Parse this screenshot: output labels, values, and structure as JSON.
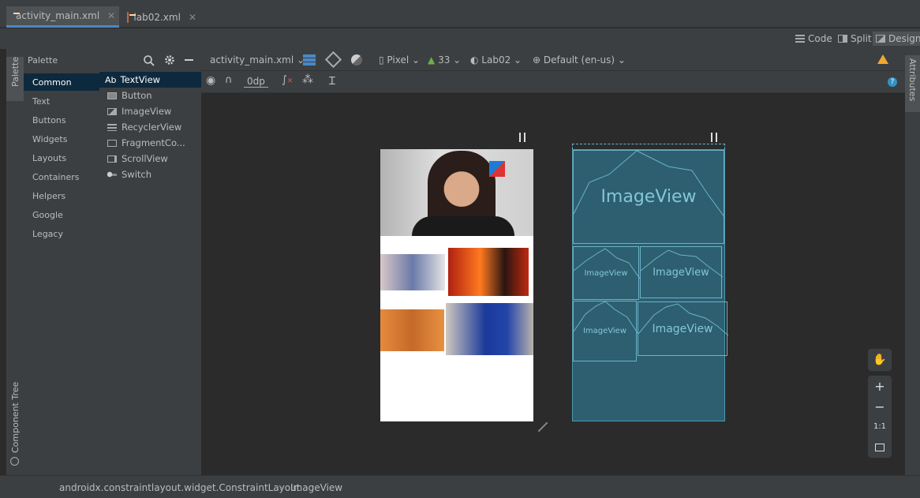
{
  "tabs": [
    {
      "label": "activity_main.xml",
      "close": "✕"
    },
    {
      "label": "lab02.xml",
      "close": "✕"
    }
  ],
  "modes": {
    "code": "Code",
    "split": "Split",
    "design": "Design"
  },
  "left_tools": {
    "palette": "Palette",
    "component_tree": "Component Tree"
  },
  "palette": {
    "title": "Palette",
    "categories": [
      "Common",
      "Text",
      "Buttons",
      "Widgets",
      "Layouts",
      "Containers",
      "Helpers",
      "Google",
      "Legacy"
    ],
    "items": [
      {
        "icon": "Ab",
        "label": "TextView"
      },
      {
        "label": "Button"
      },
      {
        "label": "ImageView"
      },
      {
        "label": "RecyclerView"
      },
      {
        "label": "FragmentCo..."
      },
      {
        "label": "ScrollView"
      },
      {
        "label": "Switch"
      }
    ]
  },
  "toolbar": {
    "file": "activity_main.xml",
    "device": "Pixel",
    "api": "33",
    "theme": "Lab02",
    "locale": "Default (en-us)",
    "margin": "0dp"
  },
  "right_tools": {
    "attributes": "Attributes"
  },
  "blueprint": {
    "label": "ImageView"
  },
  "zoom": {
    "plus": "+",
    "minus": "−",
    "ratio": "1:1"
  },
  "status": {
    "layout": "androidx.constraintlayout.widget.ConstraintLayout",
    "sep": "›",
    "selected": "ImageView"
  },
  "colors": {
    "accent": "#4a88c7",
    "blueprint_bg": "#2d5f70",
    "blueprint_line": "#69b3c7",
    "warning": "#f0a732"
  }
}
